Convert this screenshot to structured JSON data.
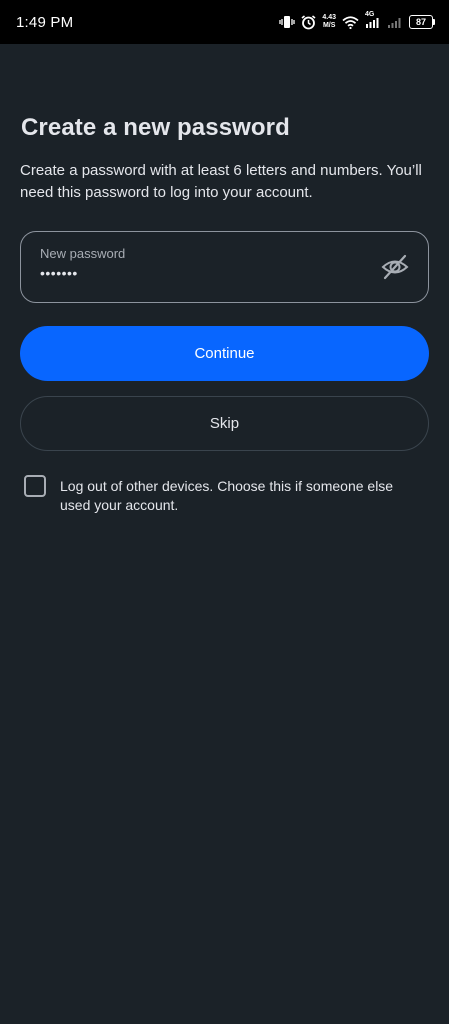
{
  "status_bar": {
    "time": "1:49 PM",
    "speed_value": "4.43",
    "speed_unit": "M/S",
    "network": "4G",
    "battery": "87"
  },
  "page": {
    "title": "Create a new password",
    "description": "Create a password with at least 6 letters and numbers. You’ll need this password to log into your account."
  },
  "password_field": {
    "label": "New password",
    "value": "•••••••",
    "visibility_icon": "eye-slash-icon"
  },
  "buttons": {
    "continue_label": "Continue",
    "skip_label": "Skip"
  },
  "logout_option": {
    "checked": false,
    "label": "Log out of other devices. Choose this if someone else used your account."
  },
  "colors": {
    "background": "#1b2228",
    "primary_button": "#0866ff",
    "text": "#e4e6eb"
  }
}
